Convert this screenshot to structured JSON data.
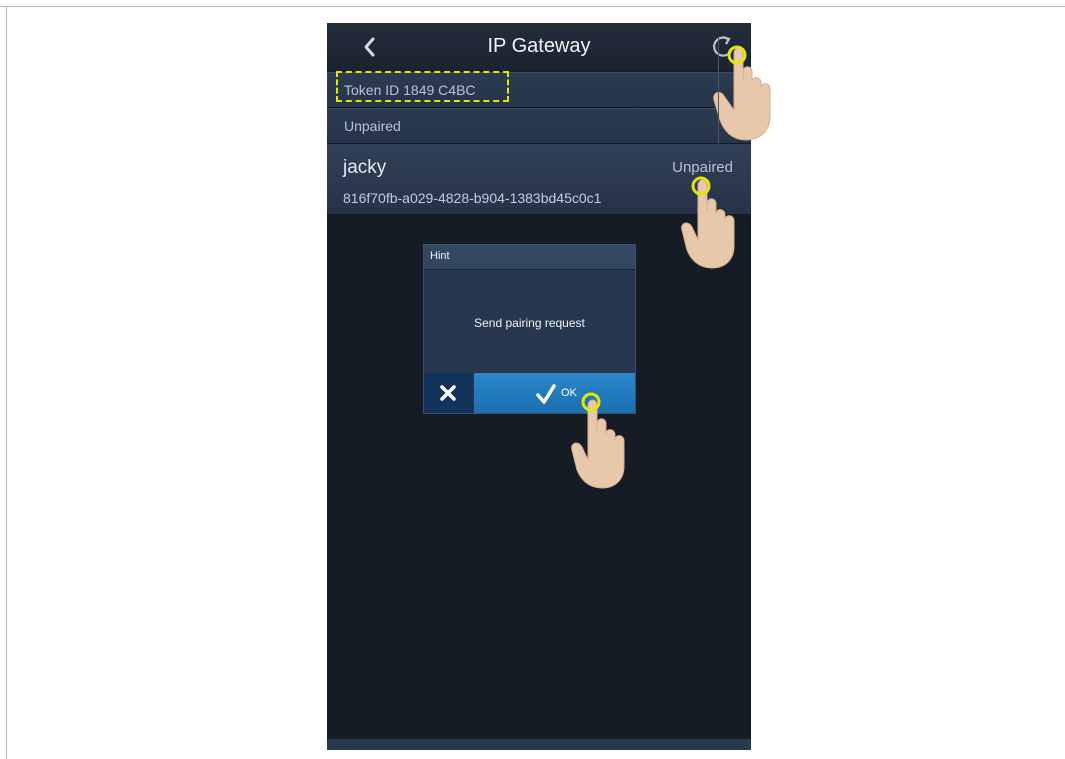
{
  "app": {
    "title": "IP Gateway"
  },
  "gateway": {
    "token_id": "Token ID 1849 C4BC",
    "status": "Unpaired"
  },
  "device": {
    "name": "jacky",
    "uuid": "816f70fb-a029-4828-b904-1383bd45c0c1",
    "status": "Unpaired"
  },
  "dialog": {
    "title": "Hint",
    "message": "Send pairing request",
    "ok_label": "OK"
  },
  "colors": {
    "background": "#161c25",
    "accent": "#1d6fae",
    "highlight": "#e6e600"
  },
  "icons": {
    "back": "chevron-left-icon",
    "refresh": "refresh-icon",
    "cancel": "close-icon",
    "ok": "check-icon",
    "pointer": "hand-pointer-icon"
  }
}
